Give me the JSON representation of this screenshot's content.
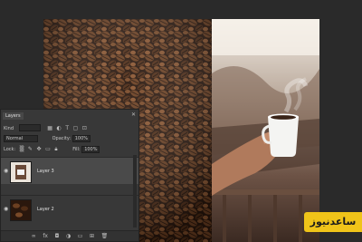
{
  "layers_panel": {
    "tab_label": "Layers",
    "kind_label": "Kind",
    "blend_mode": "Normal",
    "opacity_label": "Opacity:",
    "opacity_value": "100%",
    "lock_label": "Lock:",
    "fill_label": "Fill:",
    "fill_value": "100%",
    "layers": [
      {
        "name": "Layer 3",
        "visible": true
      },
      {
        "name": "Layer 2",
        "visible": true
      }
    ],
    "bottom_icons": [
      "link-icon",
      "fx-icon",
      "mask-icon",
      "adjustment-icon",
      "group-icon",
      "new-layer-icon",
      "trash-icon"
    ]
  },
  "watermark": {
    "text": "ساعدنیوز"
  },
  "colors": {
    "panel": "#383838",
    "watermark_bg": "#f0c419",
    "canvas_bg": "#2a2a2a"
  }
}
